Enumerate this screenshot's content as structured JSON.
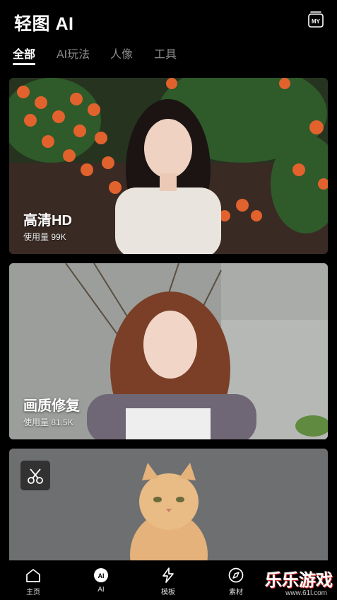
{
  "header": {
    "title": "轻图 AI",
    "my_icon_label": "MY"
  },
  "tabs": [
    {
      "label": "全部"
    },
    {
      "label": "AI玩法"
    },
    {
      "label": "人像"
    },
    {
      "label": "工具"
    }
  ],
  "cards": [
    {
      "title": "高清HD",
      "usage": "使用量 99K"
    },
    {
      "title": "画质修复",
      "usage": "使用量 81.5K"
    },
    {
      "title": "",
      "usage": ""
    }
  ],
  "bottom_nav": [
    {
      "label": "主页",
      "icon": "home-icon"
    },
    {
      "label": "AI",
      "icon": "ai-icon"
    },
    {
      "label": "模板",
      "icon": "lightning-icon"
    },
    {
      "label": "素材",
      "icon": "compass-icon"
    }
  ],
  "watermark": {
    "text": "乐乐游戏",
    "url": "www.61l.com"
  }
}
